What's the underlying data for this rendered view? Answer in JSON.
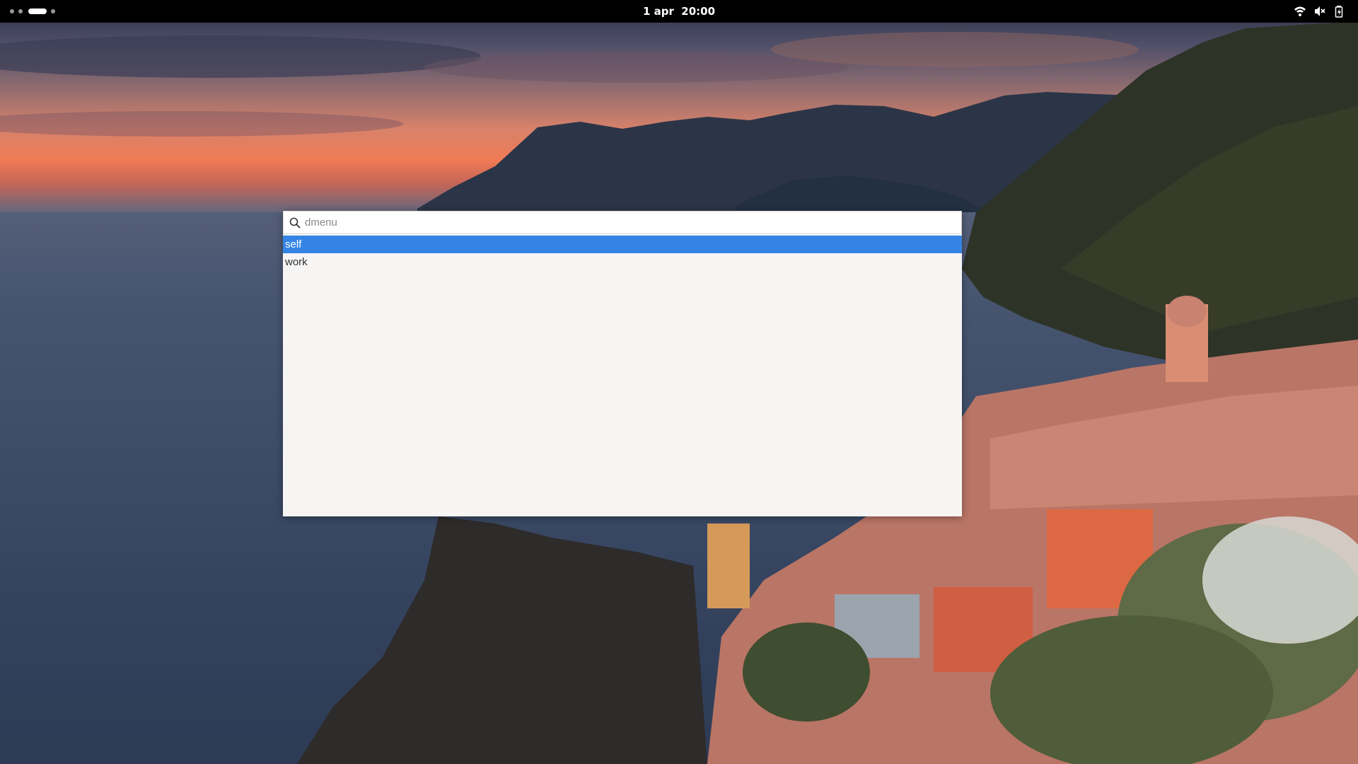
{
  "topbar": {
    "workspaces": {
      "count": 4,
      "active_index": 2
    },
    "clock": "1 apr  20:00",
    "tray_icons": [
      "wifi-icon",
      "volume-muted-icon",
      "battery-icon"
    ]
  },
  "launcher": {
    "search": {
      "placeholder": "dmenu",
      "value": ""
    },
    "results": [
      {
        "label": "self",
        "selected": true
      },
      {
        "label": "work",
        "selected": false
      }
    ]
  },
  "colors": {
    "topbar_bg": "#000000",
    "launcher_bg": "#f6f5f4",
    "selection": "#3584e4"
  }
}
